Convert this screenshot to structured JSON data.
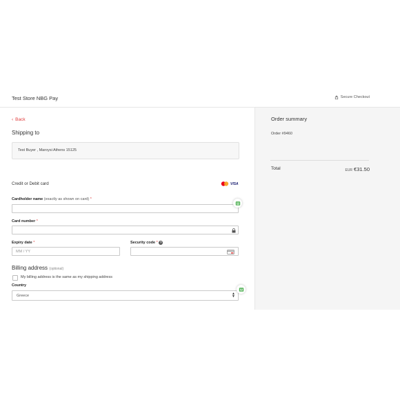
{
  "header": {
    "store_name": "Test Store NBG Pay",
    "secure_label": "Secure Checkout"
  },
  "back_label": "Back",
  "shipping": {
    "title": "Shipping to",
    "address": "Test Buyer , Maroysi Athens 15125"
  },
  "card": {
    "title": "Credit or Debit card",
    "brand_visa": "VISA",
    "cardholder_label": "Cardholder name",
    "cardholder_hint": "(exactly as shown on card)",
    "card_number_label": "Card number",
    "expiry_label": "Expiry date",
    "expiry_placeholder": "MM  /  YY",
    "security_label": "Security code",
    "required_mark": "*",
    "help_glyph": "?"
  },
  "billing": {
    "title": "Billing address",
    "optional": "(optional)",
    "same_as_shipping_label": "My billing address is the same as my shipping address",
    "country_label": "Country",
    "country_value": "Greece"
  },
  "summary": {
    "title": "Order summary",
    "order_number": "Order #9460",
    "total_label": "Total",
    "currency": "EUR",
    "total_value": "€31.50"
  },
  "colors": {
    "accent_red": "#e03c3c",
    "summary_bg": "#f5f5f5",
    "autofill_green": "#4caf50"
  }
}
